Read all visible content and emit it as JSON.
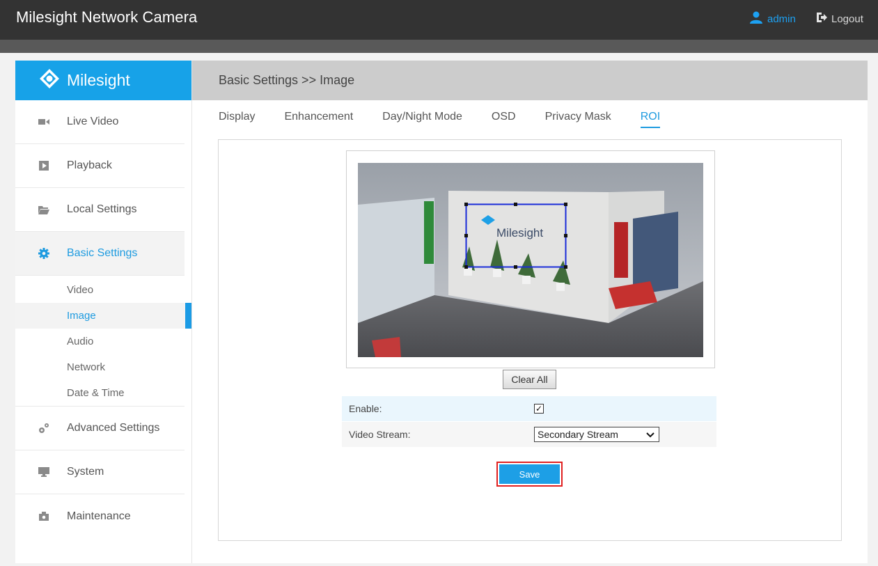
{
  "app": {
    "title": "Milesight Network Camera"
  },
  "user": {
    "name": "admin",
    "logout_label": "Logout"
  },
  "brand": {
    "logo_text": "Milesight",
    "accent": "#17a2e8"
  },
  "sidebar": {
    "items": [
      {
        "label": "Live Video",
        "icon": "video-camera-icon"
      },
      {
        "label": "Playback",
        "icon": "play-icon"
      },
      {
        "label": "Local Settings",
        "icon": "folder-icon"
      },
      {
        "label": "Basic Settings",
        "icon": "gear-icon",
        "active": true
      }
    ],
    "subitems": [
      "Video",
      "Image",
      "Audio",
      "Network",
      "Date & Time"
    ],
    "active_subitem": "Image",
    "items_after": [
      {
        "label": "Advanced Settings",
        "icon": "gears-icon"
      },
      {
        "label": "System",
        "icon": "monitor-icon"
      },
      {
        "label": "Maintenance",
        "icon": "toolbox-icon"
      }
    ]
  },
  "main": {
    "breadcrumb": "Basic Settings >> Image",
    "tabs": [
      "Display",
      "Enhancement",
      "Day/Night Mode",
      "OSD",
      "Privacy Mask",
      "ROI"
    ],
    "active_tab": "ROI"
  },
  "roi": {
    "clear_all_label": "Clear All",
    "enable_label": "Enable:",
    "enable_checked": true,
    "video_stream_label": "Video Stream:",
    "video_stream_value": "Secondary Stream",
    "save_label": "Save",
    "wall_logo_text": "Milesight"
  }
}
